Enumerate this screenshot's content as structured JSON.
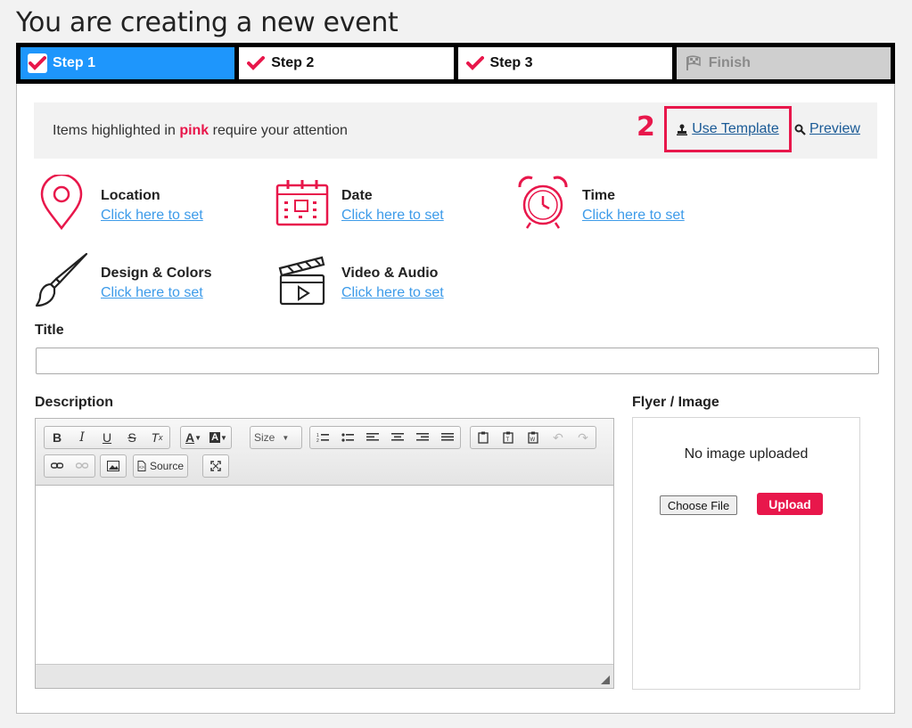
{
  "page": {
    "title": "You are creating a new event"
  },
  "steps": [
    {
      "label": "Step 1",
      "state": "active"
    },
    {
      "label": "Step 2",
      "state": "done"
    },
    {
      "label": "Step 3",
      "state": "done"
    },
    {
      "label": "Finish",
      "state": "disabled"
    }
  ],
  "notice": {
    "prefix": "Items highlighted in ",
    "highlight": "pink",
    "suffix": " require your attention"
  },
  "annotation": {
    "number": "2"
  },
  "actions": {
    "use_template": "Use Template",
    "preview": "Preview"
  },
  "features": [
    {
      "label": "Location",
      "link": "Click here to set",
      "icon": "map-pin-icon"
    },
    {
      "label": "Date",
      "link": "Click here to set",
      "icon": "calendar-icon"
    },
    {
      "label": "Time",
      "link": "Click here to set",
      "icon": "alarm-clock-icon"
    },
    {
      "label": "Design & Colors",
      "link": "Click here to set",
      "icon": "paintbrush-icon"
    },
    {
      "label": "Video & Audio",
      "link": "Click here to set",
      "icon": "clapperboard-icon"
    }
  ],
  "form": {
    "title_label": "Title",
    "title_value": "",
    "description_label": "Description",
    "flyer_label": "Flyer / Image"
  },
  "editor": {
    "size_label": "Size",
    "source_label": "Source"
  },
  "flyer": {
    "empty_text": "No image uploaded",
    "choose_label": "Choose File",
    "upload_label": "Upload"
  },
  "colors": {
    "accent": "#e8174b",
    "active_step": "#1e96fc",
    "link": "#3d9be9"
  }
}
